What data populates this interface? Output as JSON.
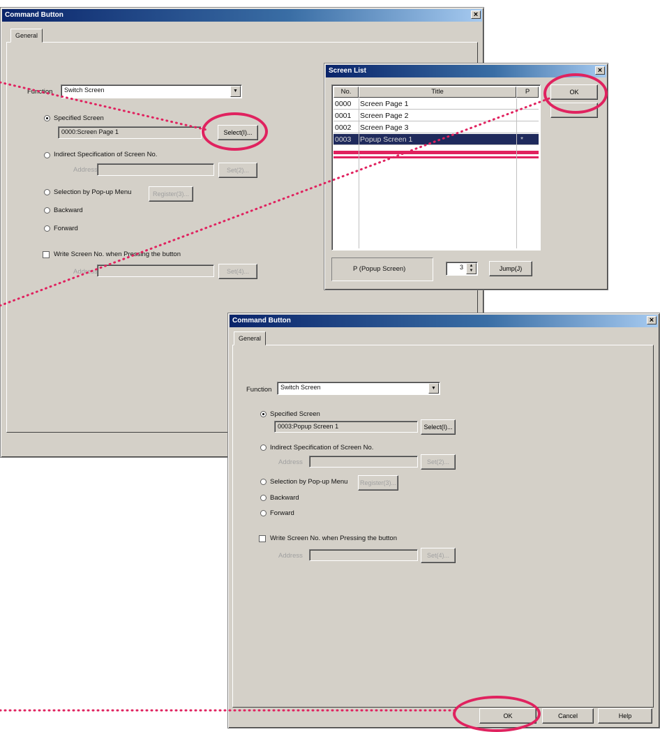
{
  "dialog1": {
    "title": "Command Button",
    "tab": "General",
    "function_label": "Function",
    "function_value": "Switch Screen",
    "options": {
      "specified": "Specified Screen",
      "specified_value": "0000:Screen Page 1",
      "select_btn": "Select(I)...",
      "indirect": "Indirect Specification of Screen No.",
      "address_label": "Address",
      "set_btn": "Set(2)...",
      "popup": "Selection by Pop-up Menu",
      "popup_btn": "Register(3)...",
      "backward": "Backward",
      "forward": "Forward",
      "write": "Write Screen No. when Pressing the button",
      "address2_label": "Address",
      "set2_btn": "Set(4)..."
    }
  },
  "screenlist": {
    "title": "Screen List",
    "col_no": "No.",
    "col_title": "Title",
    "col_p": "P",
    "rows": [
      {
        "no": "0000",
        "title": "Screen Page 1",
        "p": ""
      },
      {
        "no": "0001",
        "title": "Screen Page 2",
        "p": ""
      },
      {
        "no": "0002",
        "title": "Screen Page 3",
        "p": ""
      },
      {
        "no": "0003",
        "title": "Popup Screen 1",
        "p": "*"
      }
    ],
    "ok": "OK",
    "legend": "P (Popup Screen)",
    "jump_value": "3",
    "jump_btn": "Jump(J)"
  },
  "dialog2": {
    "title": "Command Button",
    "tab": "General",
    "function_label": "Function",
    "function_value": "Switch Screen",
    "options": {
      "specified": "Specified Screen",
      "specified_value": "0003:Popup Screen 1",
      "select_btn": "Select(I)...",
      "indirect": "Indirect Specification of Screen No.",
      "address_label": "Address",
      "set_btn": "Set(2)...",
      "popup": "Selection by Pop-up Menu",
      "popup_btn": "Register(3)...",
      "backward": "Backward",
      "forward": "Forward",
      "write": "Write Screen No. when Pressing the button",
      "address2_label": "Address",
      "set2_btn": "Set(4)..."
    },
    "ok": "OK",
    "cancel": "Cancel",
    "help": "Help"
  },
  "colors": {
    "highlight_ring": "#e0225f",
    "titlebar": "#0a246a",
    "selected_row": "#1f2a5c"
  }
}
